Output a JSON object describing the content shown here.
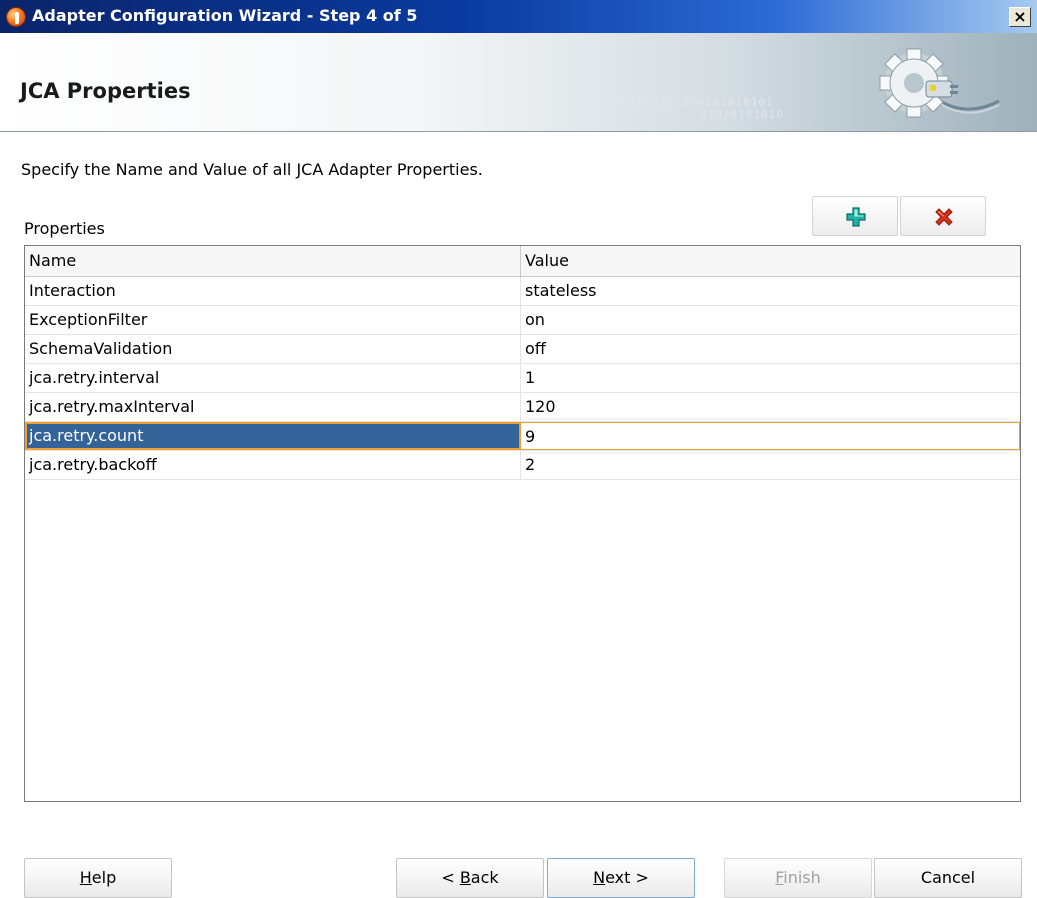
{
  "window": {
    "title": "Adapter Configuration Wizard - Step 4 of 5",
    "close_glyph": "×"
  },
  "banner": {
    "title": "JCA Properties",
    "binary_line1": "0101010101010101010101",
    "binary_line2": "01010101010"
  },
  "instruction": "Specify the Name and Value of all JCA Adapter Properties.",
  "properties": {
    "label": "Properties",
    "columns": {
      "name": "Name",
      "value": "Value"
    },
    "rows": [
      {
        "name": "Interaction",
        "value": "stateless"
      },
      {
        "name": "ExceptionFilter",
        "value": "on"
      },
      {
        "name": "SchemaValidation",
        "value": "off"
      },
      {
        "name": "jca.retry.interval",
        "value": "1"
      },
      {
        "name": "jca.retry.maxInterval",
        "value": "120"
      },
      {
        "name": "jca.retry.count",
        "value": "9",
        "selected": true
      },
      {
        "name": "jca.retry.backoff",
        "value": "2"
      }
    ]
  },
  "toolbar": {
    "add_icon": "plus-icon",
    "remove_icon": "delete-x-icon",
    "add_color": "#22b0a8",
    "remove_color": "#d9301c"
  },
  "buttons": {
    "help": {
      "mnemonic": "H",
      "rest": "elp"
    },
    "back": {
      "pre": "< ",
      "mnemonic": "B",
      "rest": "ack"
    },
    "next": {
      "mnemonic": "N",
      "rest": "ext >"
    },
    "finish": {
      "mnemonic": "F",
      "rest": "inish"
    },
    "cancel": "Cancel"
  }
}
